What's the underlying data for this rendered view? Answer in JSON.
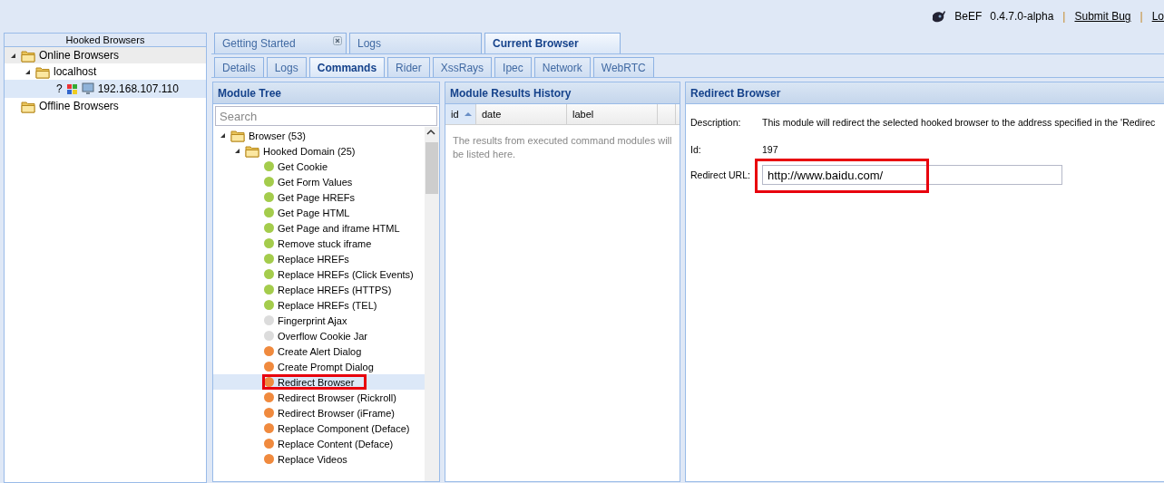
{
  "header": {
    "items": [
      {
        "kind": "text",
        "text": "BeEF"
      },
      {
        "kind": "text",
        "text": "0.4.7.0-alpha"
      },
      {
        "kind": "separator",
        "text": "|"
      },
      {
        "kind": "link",
        "text": "Submit Bug"
      },
      {
        "kind": "separator",
        "text": "|"
      },
      {
        "kind": "link",
        "text": "Lo"
      }
    ]
  },
  "hooked_browsers": {
    "title": "Hooked Browsers",
    "tree": [
      {
        "kind": "folder",
        "label": "Online Browsers",
        "expanded": true,
        "selected": false,
        "hovered": true,
        "children": [
          {
            "kind": "folder",
            "label": "localhost",
            "expanded": true,
            "selected": false,
            "children": [
              {
                "kind": "browser",
                "label": "192.168.107.110",
                "status_text": "?",
                "selected": true
              }
            ]
          }
        ]
      },
      {
        "kind": "folder",
        "label": "Offline Browsers",
        "selected": false
      }
    ]
  },
  "tabs": [
    {
      "label": "Getting Started",
      "closable": true,
      "selected": false
    },
    {
      "label": "Logs",
      "closable": false,
      "selected": false
    },
    {
      "label": "Current Browser",
      "closable": false,
      "selected": true
    }
  ],
  "sub_tabs": [
    {
      "label": "Details",
      "selected": false
    },
    {
      "label": "Logs",
      "selected": false
    },
    {
      "label": "Commands",
      "selected": true
    },
    {
      "label": "Rider",
      "selected": false
    },
    {
      "label": "XssRays",
      "selected": false
    },
    {
      "label": "Ipec",
      "selected": false
    },
    {
      "label": "Network",
      "selected": false
    },
    {
      "label": "WebRTC",
      "selected": false
    }
  ],
  "module_tree": {
    "title": "Module Tree",
    "search": {
      "placeholder": "Search"
    },
    "tree": [
      {
        "kind": "folder",
        "label": "Browser (53)",
        "expanded": true,
        "children": [
          {
            "kind": "folder",
            "label": "Hooked Domain (25)",
            "expanded": true,
            "children": [
              {
                "kind": "module",
                "label": "Get Cookie",
                "color": "#a4cc4c",
                "selected": false,
                "annotated": false
              },
              {
                "kind": "module",
                "label": "Get Form Values",
                "color": "#a4cc4c",
                "selected": false,
                "annotated": false
              },
              {
                "kind": "module",
                "label": "Get Page HREFs",
                "color": "#a4cc4c",
                "selected": false,
                "annotated": false
              },
              {
                "kind": "module",
                "label": "Get Page HTML",
                "color": "#a4cc4c",
                "selected": false,
                "annotated": false
              },
              {
                "kind": "module",
                "label": "Get Page and iframe HTML",
                "color": "#a4cc4c",
                "selected": false,
                "annotated": false
              },
              {
                "kind": "module",
                "label": "Remove stuck iframe",
                "color": "#a4cc4c",
                "selected": false,
                "annotated": false
              },
              {
                "kind": "module",
                "label": "Replace HREFs",
                "color": "#a4cc4c",
                "selected": false,
                "annotated": false
              },
              {
                "kind": "module",
                "label": "Replace HREFs (Click Events)",
                "color": "#a4cc4c",
                "selected": false,
                "annotated": false
              },
              {
                "kind": "module",
                "label": "Replace HREFs (HTTPS)",
                "color": "#a4cc4c",
                "selected": false,
                "annotated": false
              },
              {
                "kind": "module",
                "label": "Replace HREFs (TEL)",
                "color": "#a4cc4c",
                "selected": false,
                "annotated": false
              },
              {
                "kind": "module",
                "label": "Fingerprint Ajax",
                "color": "#dcdcdc",
                "selected": false,
                "annotated": false
              },
              {
                "kind": "module",
                "label": "Overflow Cookie Jar",
                "color": "#dcdcdc",
                "selected": false,
                "annotated": false
              },
              {
                "kind": "module",
                "label": "Create Alert Dialog",
                "color": "#f08a3e",
                "selected": false,
                "annotated": false
              },
              {
                "kind": "module",
                "label": "Create Prompt Dialog",
                "color": "#f08a3e",
                "selected": false,
                "annotated": false
              },
              {
                "kind": "module",
                "label": "Redirect Browser",
                "color": "#f08a3e",
                "selected": true,
                "annotated": true
              },
              {
                "kind": "module",
                "label": "Redirect Browser (Rickroll)",
                "color": "#f08a3e",
                "selected": false,
                "annotated": false
              },
              {
                "kind": "module",
                "label": "Redirect Browser (iFrame)",
                "color": "#f08a3e",
                "selected": false,
                "annotated": false
              },
              {
                "kind": "module",
                "label": "Replace Component (Deface)",
                "color": "#f08a3e",
                "selected": false,
                "annotated": false
              },
              {
                "kind": "module",
                "label": "Replace Content (Deface)",
                "color": "#f08a3e",
                "selected": false,
                "annotated": false
              },
              {
                "kind": "module",
                "label": "Replace Videos",
                "color": "#f08a3e",
                "selected": false,
                "annotated": false
              }
            ]
          }
        ]
      }
    ]
  },
  "results": {
    "title": "Module Results History",
    "columns": [
      {
        "label": "id",
        "sorted": true
      },
      {
        "label": "date",
        "sorted": false
      },
      {
        "label": "label",
        "sorted": false
      }
    ],
    "empty_text": "The results from executed command modules will be listed here."
  },
  "details": {
    "title": "Redirect Browser",
    "fields": [
      {
        "kind": "text",
        "label": "Description:",
        "value": "This module will redirect the selected hooked browser to the address specified in the 'Redirec"
      },
      {
        "kind": "text",
        "label": "Id:",
        "value": "197"
      },
      {
        "kind": "input",
        "label": "Redirect URL:",
        "value": "http://www.baidu.com/",
        "annotated": true
      }
    ]
  }
}
